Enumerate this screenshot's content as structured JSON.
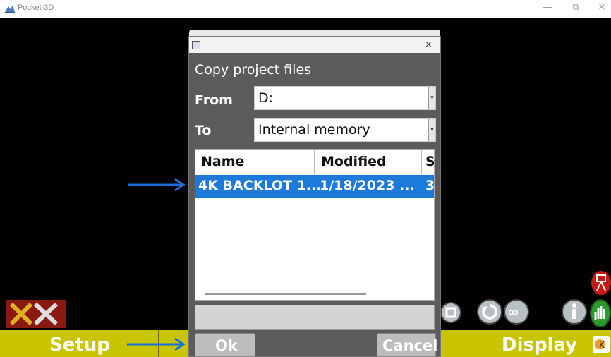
{
  "window": {
    "title": "Pocket-3D",
    "minimize": "—",
    "restore": "⧉",
    "close": "✕"
  },
  "bottom_bar": {
    "setup_label": "Setup",
    "display_label": "Display",
    "bar_color": "#c8c400"
  },
  "dialog": {
    "close": "×",
    "heading": "Copy project files",
    "from_label": "From",
    "from_value": "D:",
    "to_label": "To",
    "to_value": "Internal memory",
    "columns": [
      "Name",
      "Modified",
      "S"
    ],
    "rows": [
      {
        "name": "4K BACKLOT 1...",
        "modified": "1/18/2023 ...",
        "size": "3"
      }
    ],
    "ok_label": "Ok",
    "cancel_label": "Cancel",
    "selection_color": "#1e7ad8"
  },
  "annotations": {
    "arrow_color": "#1a6ed8"
  }
}
